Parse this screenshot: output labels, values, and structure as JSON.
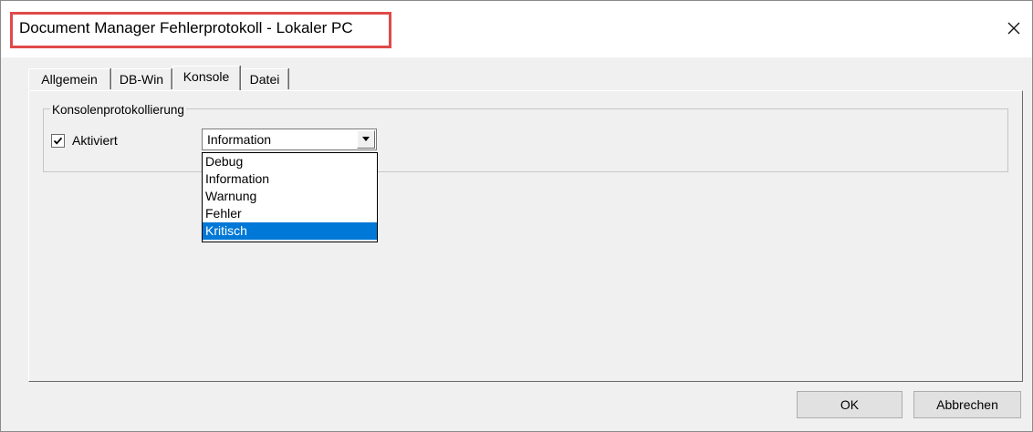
{
  "window": {
    "title": "Document Manager Fehlerprotokoll - Lokaler PC",
    "close_icon": "close-icon",
    "title_highlight_color": "#e04a4a"
  },
  "tabs": [
    {
      "label": "Allgemein",
      "active": false
    },
    {
      "label": "DB-Win",
      "active": false
    },
    {
      "label": "Konsole",
      "active": true
    },
    {
      "label": "Datei",
      "active": false
    }
  ],
  "group": {
    "legend": "Konsolenprotokollierung",
    "checkbox_label": "Aktiviert",
    "checkbox_checked": true,
    "select_value": "Information",
    "options": [
      "Debug",
      "Information",
      "Warnung",
      "Fehler",
      "Kritisch"
    ],
    "highlighted_option": "Kritisch",
    "highlight_color": "#0078d7"
  },
  "buttons": {
    "ok": "OK",
    "cancel": "Abbrechen"
  }
}
